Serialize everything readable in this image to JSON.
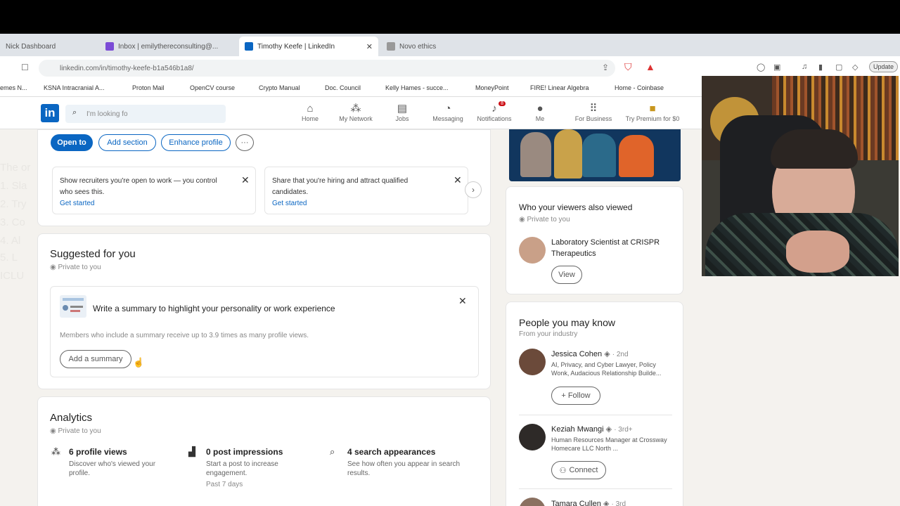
{
  "browser": {
    "tabs": [
      {
        "label": "Nick Dashboard"
      },
      {
        "label": "Inbox | emilythereconsulting@..."
      },
      {
        "label": "Timothy Keefe | LinkedIn"
      },
      {
        "label": "Novo ethics"
      }
    ],
    "url": "linkedin.com/in/timothy-keefe-b1a546b1a8/",
    "update_label": "Update",
    "bookmarks": [
      "emes N...",
      "KSNA Intracranial A...",
      "Proton Mail",
      "OpenCV course",
      "Crypto Manual",
      "Doc. Council",
      "Kelly Hames - succe...",
      "MoneyPoint",
      "FIRE! Linear Algebra",
      "Home - Coinbase"
    ]
  },
  "nav": {
    "logo": "in",
    "search_placeholder": "I'm looking fo",
    "items": [
      {
        "label": "Home",
        "icon": "home-icon"
      },
      {
        "label": "My Network",
        "icon": "network-icon"
      },
      {
        "label": "Jobs",
        "icon": "jobs-icon"
      },
      {
        "label": "Messaging",
        "icon": "messaging-icon"
      },
      {
        "label": "Notifications",
        "icon": "bell-icon",
        "badge": "8"
      },
      {
        "label": "Me",
        "icon": "avatar-icon"
      },
      {
        "label": "For Business",
        "icon": "grid-icon"
      },
      {
        "label": "Try Premium for $0",
        "icon": "premium-icon"
      }
    ]
  },
  "profile_actions": {
    "open_to": "Open to",
    "add_section": "Add section",
    "enhance": "Enhance profile",
    "more": "···"
  },
  "promo_cards": [
    {
      "text": "Show recruiters you're open to work — you control who sees this.",
      "link": "Get started"
    },
    {
      "text": "Share that you're hiring and attract qualified candidates.",
      "link": "Get started"
    }
  ],
  "suggested": {
    "title": "Suggested for you",
    "privacy": "Private to you",
    "item_title": "Write a summary to highlight your personality or work experience",
    "item_desc": "Members who include a summary receive up to 3.9 times as many profile views.",
    "button": "Add a summary"
  },
  "analytics": {
    "title": "Analytics",
    "privacy": "Private to you",
    "items": [
      {
        "title": "6 profile views",
        "desc": "Discover who's viewed your profile.",
        "icon": "people-icon"
      },
      {
        "title": "0 post impressions",
        "desc": "Start a post to increase engagement.",
        "sub": "Past 7 days",
        "icon": "bar-chart-icon"
      },
      {
        "title": "4 search appearances",
        "desc": "See how often you appear in search results.",
        "icon": "search-icon"
      }
    ]
  },
  "viewers": {
    "title": "Who your viewers also viewed",
    "privacy": "Private to you",
    "person": {
      "name": "Laboratory Scientist at CRISPR Therapeutics",
      "button": "View"
    }
  },
  "pymk": {
    "title": "People you may know",
    "subtitle": "From your industry",
    "people": [
      {
        "name": "Jessica Cohen",
        "degree": "· 2nd",
        "headline": "AI, Privacy, and Cyber Lawyer, Policy Wonk, Audacious Relationship Builde...",
        "button": "+ Follow"
      },
      {
        "name": "Keziah Mwangi",
        "degree": "· 3rd+",
        "headline": "Human Resources Manager at Crossway Homecare LLC North ...",
        "button": "Connect"
      },
      {
        "name": "Tamara Cullen",
        "degree": "· 3rd"
      }
    ]
  },
  "left_overlay": [
    "The or",
    "1. Sla",
    "2. Try",
    "3. Co",
    "4. Al",
    "5. L",
    "ICLU"
  ]
}
